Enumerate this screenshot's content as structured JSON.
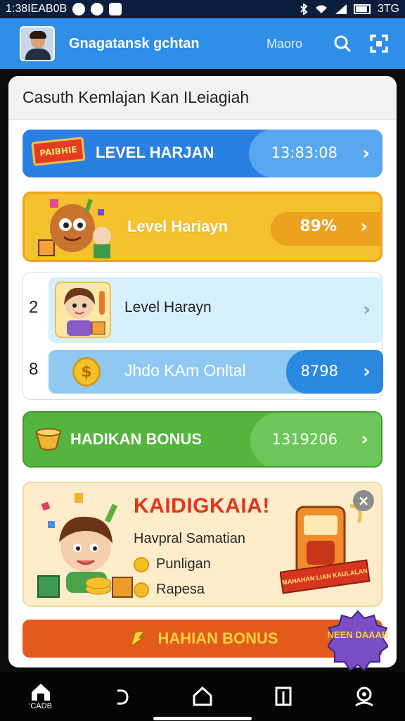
{
  "status_bar": {
    "left_text": "1:38IEAB0B",
    "right_text": "3TG"
  },
  "header": {
    "title": "Gnagatansk gchtan",
    "link": "Maoro"
  },
  "panel": {
    "heading": "Casuth Kemlajan Kan ILeiagiah",
    "rows": [
      {
        "badge": "PAIBHIE",
        "label": "LEVEL HARJAN",
        "value": "13:83:08"
      },
      {
        "label": "Level Hariayn",
        "value": "89%"
      }
    ],
    "group": {
      "items": [
        {
          "num": "2",
          "label": "Level Harayn"
        },
        {
          "num": "8",
          "label": "Jhdo KAm Onltal",
          "value": "8798"
        }
      ]
    },
    "bonus_row": {
      "label": "HADIKAN BONUS",
      "value": "1319206"
    },
    "promo": {
      "title": "KAIDIGKAIA!",
      "subtitle": "Havpral Samatian",
      "items": [
        "Punligan",
        "Rapesa"
      ],
      "machine_text": "MAHAHAN LIAN KAULALAN"
    },
    "bottom_button": {
      "label": "HAHIAN BONUS"
    },
    "new_badge": "NEEN DAAAB"
  },
  "nav": {
    "home_label": "'CADB"
  },
  "colors": {
    "header": "#2f8ee8",
    "status": "#0b1f3c"
  }
}
